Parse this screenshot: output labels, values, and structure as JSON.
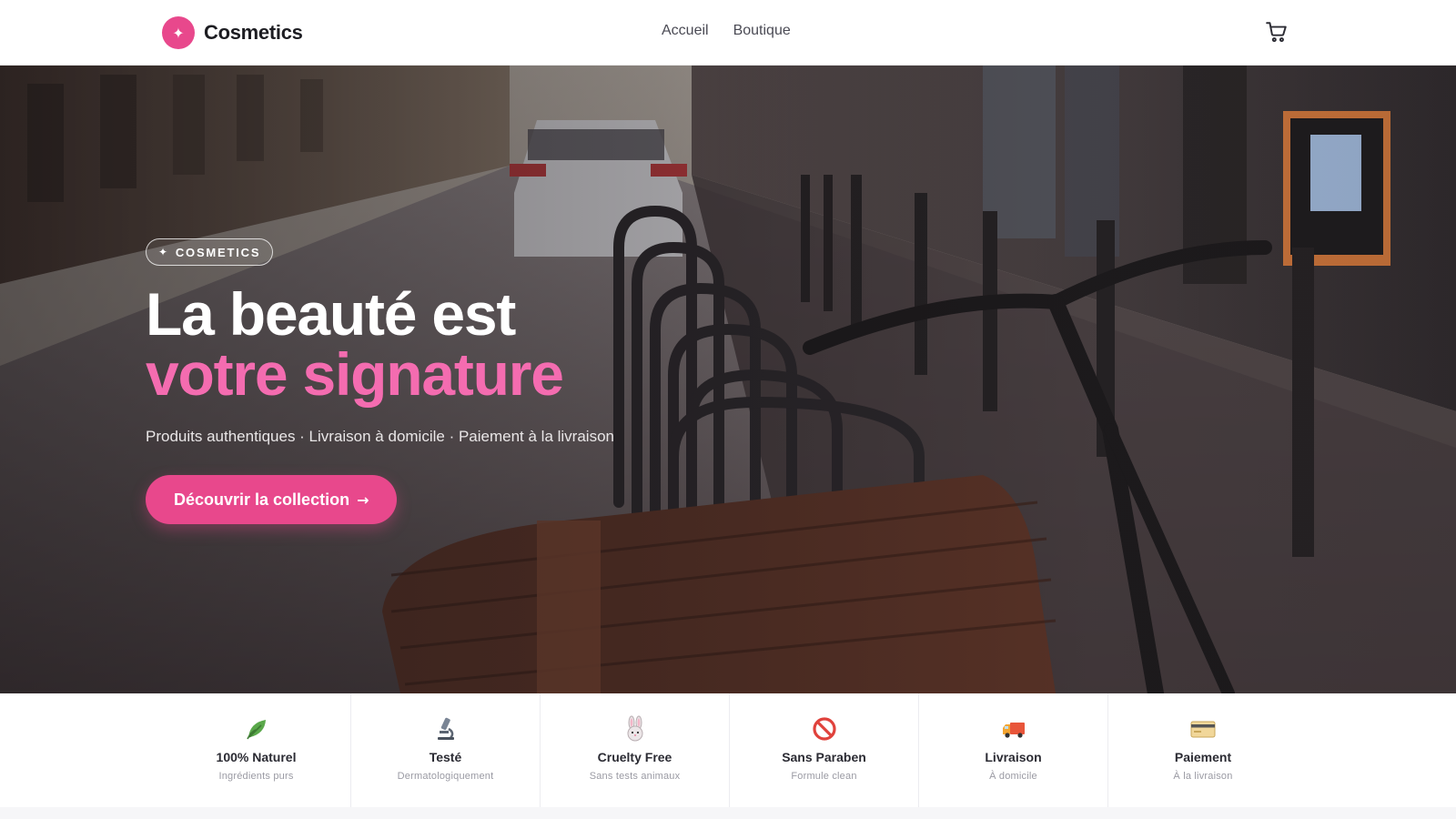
{
  "header": {
    "brand": "Cosmetics",
    "brand_logo_icon": "sparkle-icon",
    "nav": [
      {
        "label": "Accueil"
      },
      {
        "label": "Boutique"
      }
    ],
    "cart_icon": "cart-icon"
  },
  "hero": {
    "badge": "COSMETICS",
    "title_line1": "La beauté est",
    "title_line2": "votre signature",
    "subtitle": "Produits authentiques · Livraison à domicile · Paiement à la livraison",
    "cta_label": "Découvrir la collection",
    "cta_arrow": "→"
  },
  "features": [
    {
      "icon": "leaf-icon",
      "title": "100% Naturel",
      "subtitle": "Ingrédients purs"
    },
    {
      "icon": "microscope-icon",
      "title": "Testé",
      "subtitle": "Dermatologiquement"
    },
    {
      "icon": "rabbit-icon",
      "title": "Cruelty Free",
      "subtitle": "Sans tests animaux"
    },
    {
      "icon": "no-entry-icon",
      "title": "Sans Paraben",
      "subtitle": "Formule clean"
    },
    {
      "icon": "truck-icon",
      "title": "Livraison",
      "subtitle": "À domicile"
    },
    {
      "icon": "card-icon",
      "title": "Paiement",
      "subtitle": "À la livraison"
    }
  ],
  "colors": {
    "accent": "#e8488c",
    "accent_light": "#f46cb0",
    "text_dark": "#1d1d22"
  }
}
